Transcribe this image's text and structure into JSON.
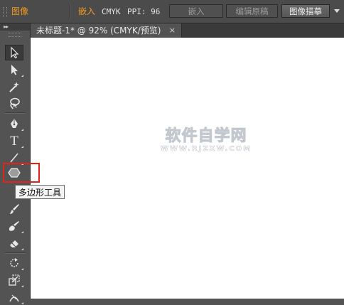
{
  "control_bar": {
    "image_label": "图像",
    "embed_label": "嵌入",
    "color_mode": "CMYK",
    "ppi_label": "PPI: 96",
    "embed_button": "嵌入",
    "edit_original_button": "编辑原稿",
    "image_trace_button": "图像描摹"
  },
  "tools": {
    "collapse_glyph": "▸▸",
    "items": [
      {
        "name": "selection-tool",
        "icon": "selection-arrow-icon",
        "selected": true
      },
      {
        "name": "direct-selection-tool",
        "icon": "direct-selection-arrow-icon"
      },
      {
        "name": "magic-wand-tool",
        "icon": "magic-wand-icon"
      },
      {
        "name": "lasso-tool",
        "icon": "lasso-icon"
      },
      {
        "name": "pen-tool",
        "icon": "pen-icon"
      },
      {
        "name": "type-tool",
        "icon": "type-icon",
        "glyph": "T"
      },
      {
        "name": "line-segment-tool",
        "icon": "line-icon"
      },
      {
        "name": "polygon-tool",
        "icon": "polygon-icon",
        "active": true
      },
      {
        "name": "paintbrush-tool",
        "icon": "paintbrush-icon"
      },
      {
        "name": "blob-brush-tool",
        "icon": "blob-brush-icon"
      },
      {
        "name": "eraser-tool",
        "icon": "eraser-icon"
      },
      {
        "name": "rotate-tool",
        "icon": "rotate-icon"
      },
      {
        "name": "scale-tool",
        "icon": "scale-icon"
      },
      {
        "name": "width-tool",
        "icon": "width-icon"
      }
    ],
    "tooltip": "多边形工具"
  },
  "document": {
    "tab_title": "未标题-1* @ 92% (CMYK/预览)",
    "tab_close": "×"
  },
  "watermark": {
    "main": "软件自学网",
    "sub": "WWW.RJZXW.COM"
  },
  "colors": {
    "accent_orange": "#f39a1c",
    "highlight_red": "#e2231a",
    "panel_bg": "#535353",
    "canvas": "#ffffff"
  }
}
